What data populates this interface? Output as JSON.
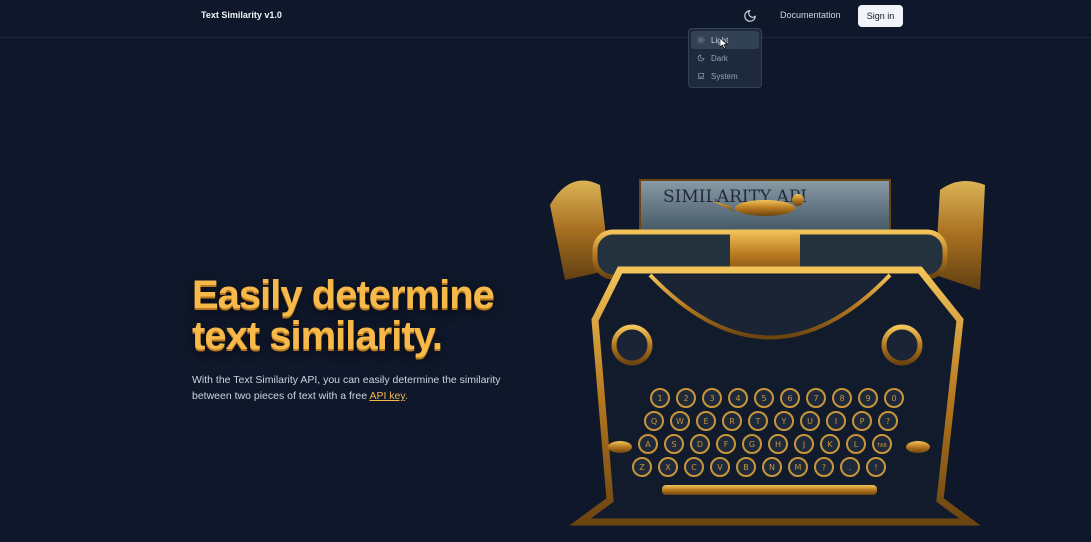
{
  "header": {
    "brand": "Text Similarity v1.0",
    "documentation_label": "Documentation",
    "signin_label": "Sign in"
  },
  "theme_menu": {
    "items": [
      {
        "label": "Light",
        "icon": "sun-icon"
      },
      {
        "label": "Dark",
        "icon": "moon-icon"
      },
      {
        "label": "System",
        "icon": "laptop-icon"
      }
    ]
  },
  "hero": {
    "title_line1": "Easily determine",
    "title_line2": "text similarity.",
    "description_prefix": "With the Text Similarity API, you can easily determine the similarity between two pieces of text with a free ",
    "description_link": "API key",
    "description_suffix": "."
  },
  "illustration": {
    "paper_text": "SIMILARITY API",
    "key_rows": [
      [
        "1",
        "2",
        "3",
        "4",
        "5",
        "6",
        "7",
        "8",
        "9",
        "0"
      ],
      [
        "Q",
        "W",
        "E",
        "R",
        "T",
        "Y",
        "U",
        "I",
        "P",
        "?"
      ],
      [
        "A",
        "S",
        "D",
        "F",
        "G",
        "H",
        "J",
        "K",
        "L",
        "TAB"
      ],
      [
        "Z",
        "X",
        "C",
        "V",
        "B",
        "N",
        "M",
        "?",
        ".",
        "!"
      ]
    ]
  },
  "colors": {
    "background": "#0f172a",
    "accent": "#f6b94a",
    "menu_bg": "#1e293b"
  }
}
